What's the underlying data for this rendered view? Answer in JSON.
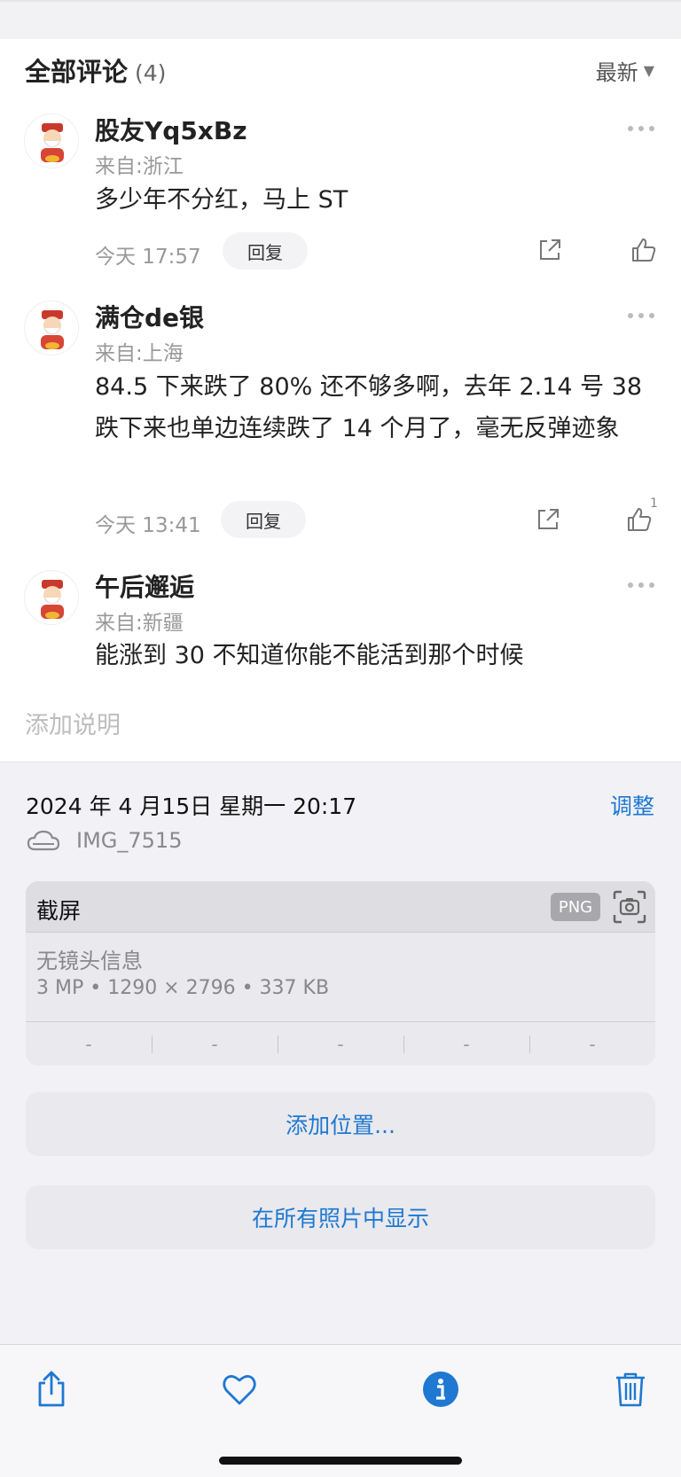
{
  "comments": {
    "title": "全部评论",
    "count": "(4)",
    "sort_label": "最新",
    "items": [
      {
        "username": "股友Yq5xBz",
        "location": "来自:浙江",
        "text": "多少年不分红，马上 ST",
        "time": "今天 17:57",
        "reply_label": "回复",
        "likes": ""
      },
      {
        "username": "满仓de银",
        "location": "来自:上海",
        "text": "84.5 下来跌了 80% 还不够多啊，去年 2.14 号 38 跌下来也单边连续跌了 14 个月了，毫无反弹迹象",
        "time": "今天 13:41",
        "reply_label": "回复",
        "likes": "1"
      },
      {
        "username": "午后邂逅",
        "location": "来自:新疆",
        "text": "能涨到 30 不知道你能不能活到那个时候"
      }
    ]
  },
  "caption_placeholder": "添加说明",
  "photo_info": {
    "datetime": "2024 年 4 月15日 星期一 20:17",
    "adjust_label": "调整",
    "filename": "IMG_7515",
    "type_label": "截屏",
    "format_badge": "PNG",
    "lens_info": "无镜头信息",
    "specs": "3 MP  •  1290 × 2796  •  337 KB",
    "exif": [
      "-",
      "-",
      "-",
      "-",
      "-"
    ]
  },
  "actions": {
    "add_location": "添加位置...",
    "show_in_all_photos": "在所有照片中显示"
  },
  "toolbar": {
    "icons": [
      "share-icon",
      "heart-icon",
      "info-icon",
      "trash-icon"
    ]
  },
  "colors": {
    "accent_blue": "#1f78d1",
    "info_background": "#f2f2f6",
    "card_background": "#e9e9ee"
  }
}
